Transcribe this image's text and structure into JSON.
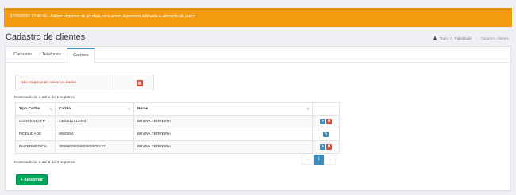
{
  "notice": {
    "text": "17/05/2022 17:46:46 - Faltam etiquetas de gôndola para serem impressas referente a alteração de preço."
  },
  "header": {
    "title": "Cadastro de clientes"
  },
  "breadcrumb": {
    "home_icon": "user-icon",
    "home": "Topo",
    "section_icon": "circle-icon",
    "section": "Fidelidade",
    "current": "Cadastro clientes"
  },
  "tabs": [
    {
      "label": "Cadastro"
    },
    {
      "label": "Telefones"
    },
    {
      "label": "Cartões"
    }
  ],
  "active_tab": "Cartões",
  "warning": {
    "message": "Não esqueça de salvar os dados",
    "icon": "file-pdf-icon"
  },
  "table_info_top": "Mostrando de 1 até 1 de 1 registros",
  "table": {
    "columns": [
      "Tipo Cartão",
      "Cartão",
      "Nome",
      ""
    ],
    "rows": [
      {
        "tipo": "CONVENIO FP",
        "cartao": "2300211713440",
        "nome": "BRUNA FERREIRA",
        "edit": true,
        "delete": true
      },
      {
        "tipo": "FIDELIDADE",
        "cartao": "9000284",
        "nome": "BRUNA FERREIRA",
        "edit": true,
        "delete": false
      },
      {
        "tipo": "PHTERMEDICA",
        "cartao": "3099900000000000000127",
        "nome": "BRUNA FERREIRA",
        "edit": true,
        "delete": true
      }
    ]
  },
  "table_info_bottom": "Mostrando de 1 até 3 de 3 registros",
  "pagination": {
    "prev": "←",
    "current": "1",
    "next": "→"
  },
  "add_button": {
    "label": "+ Adicionar"
  },
  "colors": {
    "notice": "#f39c12",
    "primary": "#3c8dbc",
    "danger": "#dd4b39",
    "success": "#00a65a"
  }
}
